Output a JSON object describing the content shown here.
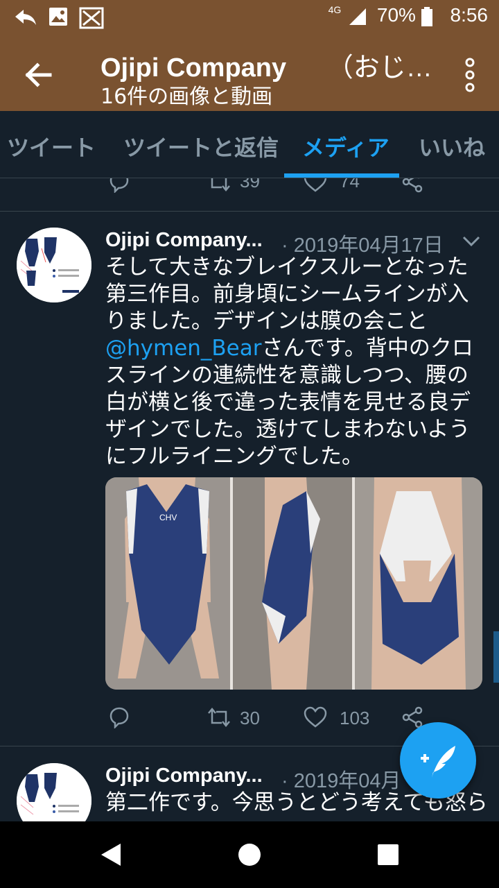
{
  "status_bar": {
    "network": "4G",
    "battery": "70%",
    "time": "8:56"
  },
  "header": {
    "title": "Ojipi Company",
    "title_suffix": "（おじ…",
    "subtitle": "16件の画像と動画"
  },
  "tabs": [
    {
      "label": "ツイート"
    },
    {
      "label": "ツイートと返信"
    },
    {
      "label": "メディア",
      "active": true
    },
    {
      "label": "いいね"
    }
  ],
  "previous_tweet": {
    "retweets": "39",
    "likes": "74"
  },
  "tweets": [
    {
      "author": "Ojipi Company...",
      "date": "· 2019年04月17日",
      "text_before": "そして大きなブレイクスルーとなった第三作目。前身頃にシームラインが入りました。デザインは膜の会こと",
      "mention": "@hymen_Bear",
      "text_after": "さんです。背中のクロスラインの連続性を意識しつつ、腰の白が横と後で違った表情を見せる良デザインでした。透けてしまわないようにフルライニングでした。",
      "image_text": "CHV",
      "retweets": "30",
      "likes": "103"
    },
    {
      "author": "Ojipi Company...",
      "date": "· 2019年04月",
      "text": "第二作です。今思うとどう考えても怒ら"
    }
  ],
  "colors": {
    "background": "#15202b",
    "header": "#7a5230",
    "accent": "#1da1f2",
    "muted": "#8899a6",
    "divider": "#38444d"
  },
  "icons": [
    "back-arrow-icon",
    "more-vert-icon",
    "reply-icon",
    "retweet-icon",
    "like-icon",
    "share-icon",
    "compose-icon",
    "chevron-down-icon",
    "nav-back-icon",
    "nav-home-icon",
    "nav-recents-icon"
  ]
}
